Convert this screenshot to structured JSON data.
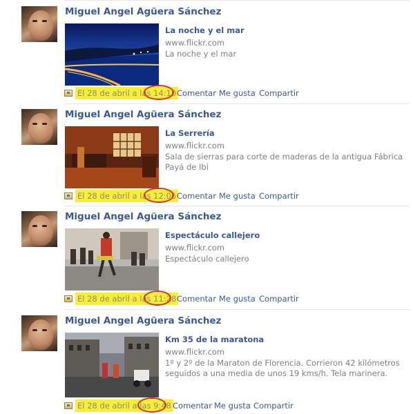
{
  "feed": {
    "posts": [
      {
        "author": "Miguel Angel Agüera Sánchez",
        "link_title": "La noche y el mar",
        "domain": "www.flickr.com",
        "description": "La noche y el mar",
        "timestamp_prefix": "El 28 de abril a las ",
        "time": "14:10",
        "comment": "Comentar",
        "like": "Me gusta",
        "share": "Compartir",
        "separator": "·"
      },
      {
        "author": "Miguel Angel Agüera Sánchez",
        "link_title": "La Serrería",
        "domain": "www.flickr.com",
        "description": "Sala de sierras para corte de maderas de la antigua Fábrica Payá de Ibi",
        "timestamp_prefix": "El 28 de abril a las ",
        "time": "12:06",
        "comment": "Comentar",
        "like": "Me gusta",
        "share": "Compartir",
        "separator": "·"
      },
      {
        "author": "Miguel Angel Agüera Sánchez",
        "link_title": "Espectáculo callejero",
        "domain": "www.flickr.com",
        "description": "Espectáculo callejero",
        "timestamp_prefix": "El 28 de abril a las ",
        "time": "11:28",
        "comment": "Comentar",
        "like": "Me gusta",
        "share": "Compartir",
        "separator": "·"
      },
      {
        "author": "Miguel Angel Agüera Sánchez",
        "link_title": "Km 35 de la maratona",
        "domain": "www.flickr.com",
        "description": "1º y 2º de la Maraton de Florencia. Corrieron 42 kilómetros seguidos a una media de unos 19 kms/h. Tela marinera.",
        "timestamp_prefix": "El 28 de abril a las ",
        "time": "9:48",
        "comment": "Comentar",
        "like": "Me gusta",
        "share": "Compartir",
        "separator": "·"
      }
    ]
  },
  "colors": {
    "link_blue": "#3b5998",
    "highlight_yellow": "#f9ef32",
    "annotation_red": "#e12b1f",
    "muted_gray": "#808080"
  },
  "icons": {
    "attachment": "link-attachment-icon"
  }
}
